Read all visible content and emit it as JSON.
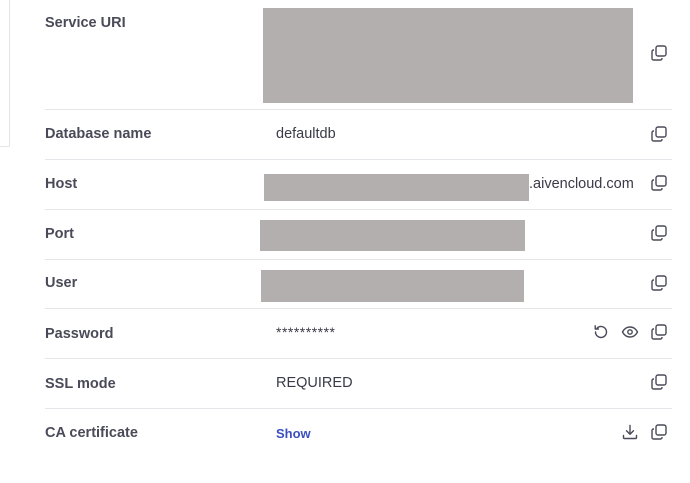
{
  "connection_info": {
    "service_uri": {
      "label": "Service URI"
    },
    "database_name": {
      "label": "Database name",
      "value": "defaultdb"
    },
    "host": {
      "label": "Host",
      "value_suffix": ".aivencloud.com"
    },
    "port": {
      "label": "Port"
    },
    "user": {
      "label": "User"
    },
    "password": {
      "label": "Password",
      "value": "**********"
    },
    "ssl_mode": {
      "label": "SSL mode",
      "value": "REQUIRED"
    },
    "ca_certificate": {
      "label": "CA certificate",
      "link": "Show"
    }
  },
  "icons": {
    "copy": "copy-icon",
    "reset": "reset-password-icon",
    "view": "eye-icon",
    "download": "download-icon"
  },
  "colors": {
    "label": "#4a4a58",
    "value": "#3a3a48",
    "link": "#3b4fbf",
    "divider": "#e6e6ea",
    "redaction": "#b3afae",
    "icon": "#4a4a58"
  }
}
